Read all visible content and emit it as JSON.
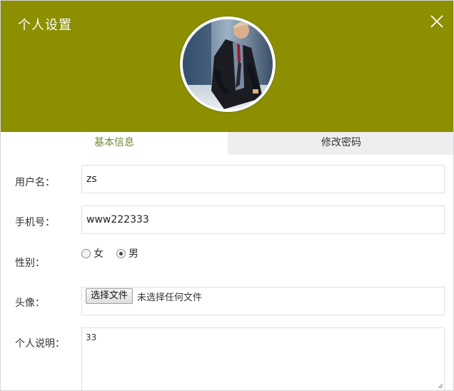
{
  "dialog": {
    "title": "个人设置"
  },
  "avatar": {
    "icon": "user-avatar-photo"
  },
  "tabs": [
    {
      "label": "基本信息",
      "active": true
    },
    {
      "label": "修改密码",
      "active": false
    }
  ],
  "form": {
    "username": {
      "label": "用户名：",
      "value": "zs"
    },
    "phone": {
      "label": "手机号：",
      "value": "www222333"
    },
    "gender": {
      "label": "性别：",
      "options": [
        {
          "label": "女",
          "checked": false
        },
        {
          "label": "男",
          "checked": true
        }
      ]
    },
    "avatar_upload": {
      "label": "头像：",
      "button": "选择文件",
      "status": "未选择任何文件"
    },
    "bio": {
      "label": "个人说明：",
      "value": "33"
    }
  },
  "colors": {
    "header_bg": "#8b8f00",
    "tab_active_text": "#6f8a32",
    "tab_inactive_bg": "#eeeeee"
  }
}
